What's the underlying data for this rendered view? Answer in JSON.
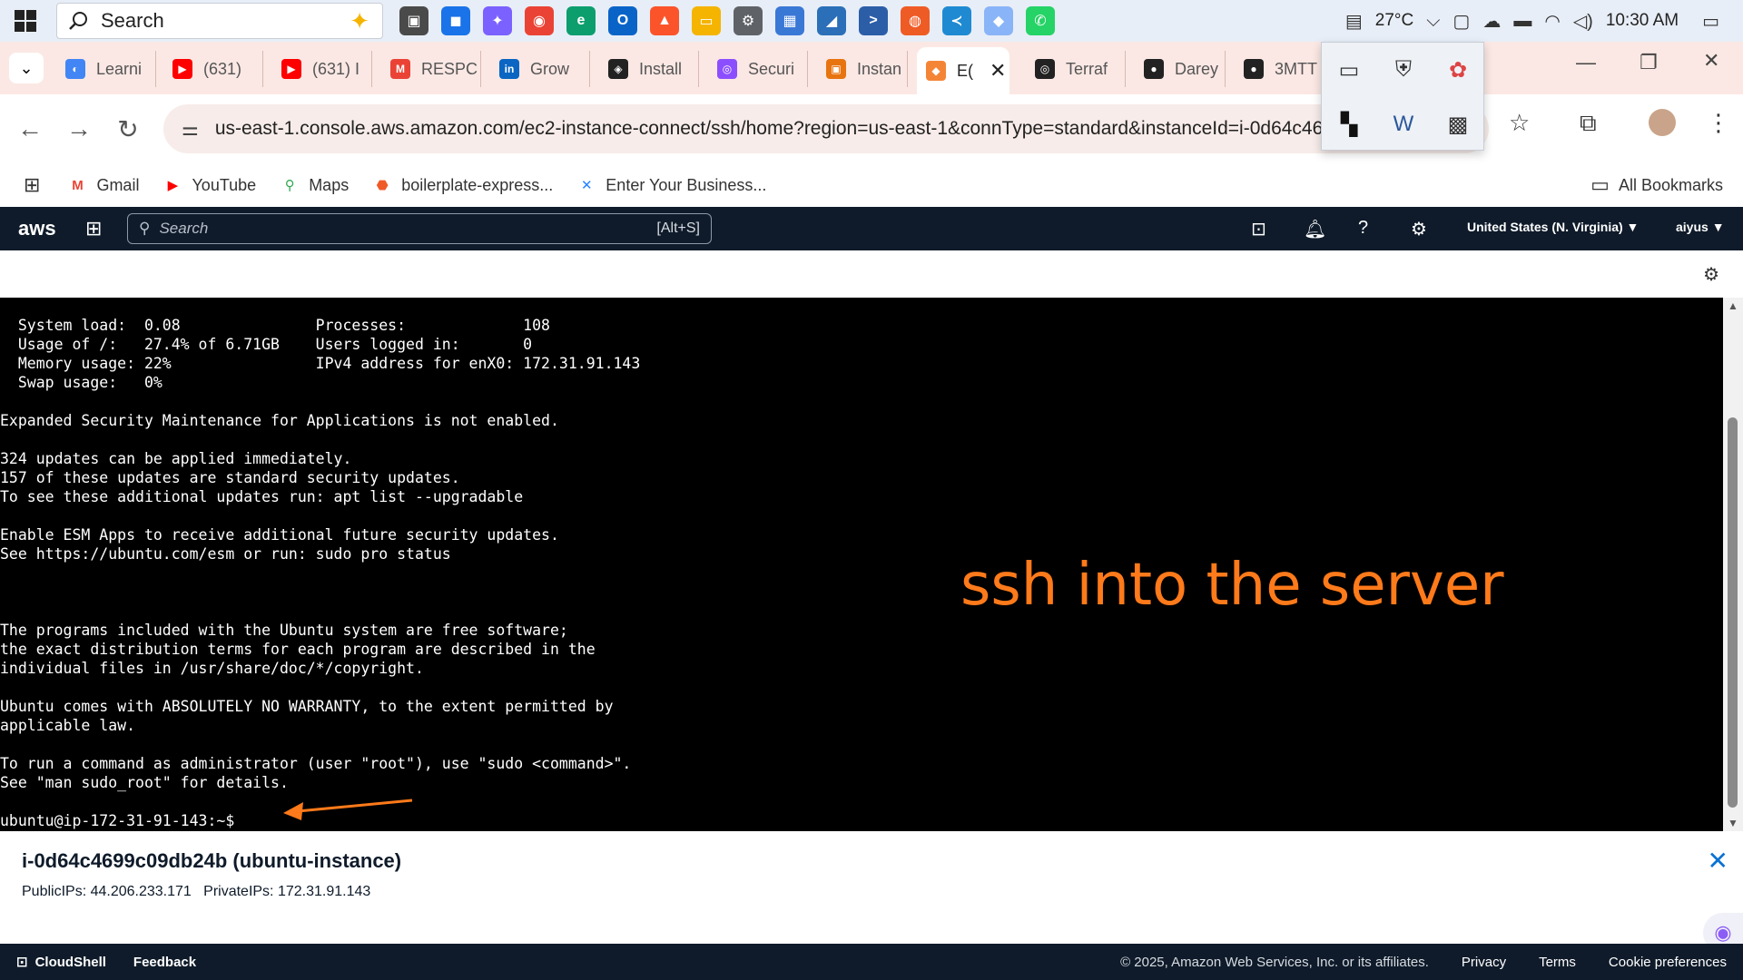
{
  "taskbar": {
    "search_placeholder": "Search",
    "apps": [
      {
        "name": "task-view",
        "color": "#4a4a4a",
        "glyph": "▣"
      },
      {
        "name": "store",
        "color": "#1a73e8",
        "glyph": "◼"
      },
      {
        "name": "copilot",
        "color": "#7b61ff",
        "glyph": "✦"
      },
      {
        "name": "chrome",
        "color": "#ea4335",
        "glyph": "◉"
      },
      {
        "name": "edge",
        "color": "#0d9e6e",
        "glyph": "e"
      },
      {
        "name": "outlook",
        "color": "#0a64c8",
        "glyph": "O"
      },
      {
        "name": "brave",
        "color": "#fb542b",
        "glyph": "▲"
      },
      {
        "name": "file-explorer",
        "color": "#f5b400",
        "glyph": "▭"
      },
      {
        "name": "settings",
        "color": "#5f6368",
        "glyph": "⚙"
      },
      {
        "name": "control-panel",
        "color": "#3a78d6",
        "glyph": "▦"
      },
      {
        "name": "azure-data-studio",
        "color": "#2b6fb8",
        "glyph": "◢"
      },
      {
        "name": "powershell",
        "color": "#2c5ea8",
        "glyph": ">"
      },
      {
        "name": "postman",
        "color": "#ef5b25",
        "glyph": "◍"
      },
      {
        "name": "vscode",
        "color": "#1f8ad2",
        "glyph": "≺"
      },
      {
        "name": "gemini",
        "color": "#8ab4f8",
        "glyph": "◆"
      },
      {
        "name": "whatsapp",
        "color": "#25d366",
        "glyph": "✆"
      }
    ],
    "temperature": "27°C",
    "time": "10:30 AM"
  },
  "tabs": [
    {
      "title": "Learni",
      "fav_color": "#4285f4",
      "fav": "◐"
    },
    {
      "title": "(631)",
      "fav_color": "#ff0000",
      "fav": "▶"
    },
    {
      "title": "(631) I",
      "fav_color": "#ff0000",
      "fav": "▶"
    },
    {
      "title": "RESPC",
      "fav_color": "#ea4335",
      "fav": "M"
    },
    {
      "title": "Grow",
      "fav_color": "#0a66c2",
      "fav": "in"
    },
    {
      "title": "Install",
      "fav_color": "#222222",
      "fav": "◈"
    },
    {
      "title": "Securi",
      "fav_color": "#8c4fff",
      "fav": "◎"
    },
    {
      "title": "Instan",
      "fav_color": "#e7740f",
      "fav": "▣"
    },
    {
      "title": "E(",
      "fav_color": "#f58536",
      "fav": "◆",
      "active": true
    },
    {
      "title": "Terraf",
      "fav_color": "#222222",
      "fav": "◎"
    },
    {
      "title": "Darey",
      "fav_color": "#222222",
      "fav": "●"
    },
    {
      "title": "3MTT",
      "fav_color": "#222222",
      "fav": "●"
    }
  ],
  "tray_popup": [
    "laptop-icon",
    "shield-icon",
    "bug-icon",
    "app-icon",
    "word-icon",
    "app-dark-icon"
  ],
  "address": {
    "url": "us-east-1.console.aws.amazon.com/ec2-instance-connect/ssh/home?region=us-east-1&connType=standard&instanceId=i-0d64c46"
  },
  "bookmarks": [
    {
      "label": "Gmail",
      "color": "#ea4335",
      "glyph": "M"
    },
    {
      "label": "YouTube",
      "color": "#ff0000",
      "glyph": "▶"
    },
    {
      "label": "Maps",
      "color": "#34a853",
      "glyph": "⚲"
    },
    {
      "label": "boilerplate-express...",
      "color": "#f05a28",
      "glyph": "⬣"
    },
    {
      "label": "Enter Your Business...",
      "color": "#2684ff",
      "glyph": "✕"
    }
  ],
  "all_bookmarks_label": "All Bookmarks",
  "aws": {
    "search_placeholder": "Search",
    "search_hint": "[Alt+S]",
    "region": "United States (N. Virginia) ▼",
    "user": "aiyus ▼"
  },
  "terminal": {
    "lines": [
      "  System load:  0.08               Processes:             108",
      "  Usage of /:   27.4% of 6.71GB    Users logged in:       0",
      "  Memory usage: 22%                IPv4 address for enX0: 172.31.91.143",
      "  Swap usage:   0%",
      "",
      "Expanded Security Maintenance for Applications is not enabled.",
      "",
      "324 updates can be applied immediately.",
      "157 of these updates are standard security updates.",
      "To see these additional updates run: apt list --upgradable",
      "",
      "Enable ESM Apps to receive additional future security updates.",
      "See https://ubuntu.com/esm or run: sudo pro status",
      "",
      "",
      "",
      "The programs included with the Ubuntu system are free software;",
      "the exact distribution terms for each program are described in the",
      "individual files in /usr/share/doc/*/copyright.",
      "",
      "Ubuntu comes with ABSOLUTELY NO WARRANTY, to the extent permitted by",
      "applicable law.",
      "",
      "To run a command as administrator (user \"root\"), use \"sudo <command>\".",
      "See \"man sudo_root\" for details.",
      "",
      "ubuntu@ip-172-31-91-143:~$"
    ],
    "annotation": "ssh into the server",
    "annotation_color": "#ff7a1a"
  },
  "instance": {
    "title": "i-0d64c4699c09db24b (ubuntu-instance)",
    "ips": "PublicIPs: 44.206.233.171   PrivateIPs: 172.31.91.143"
  },
  "footer": {
    "cloudshell": "CloudShell",
    "feedback": "Feedback",
    "copyright": "© 2025, Amazon Web Services, Inc. or its affiliates.",
    "privacy": "Privacy",
    "terms": "Terms",
    "cookies": "Cookie preferences"
  }
}
